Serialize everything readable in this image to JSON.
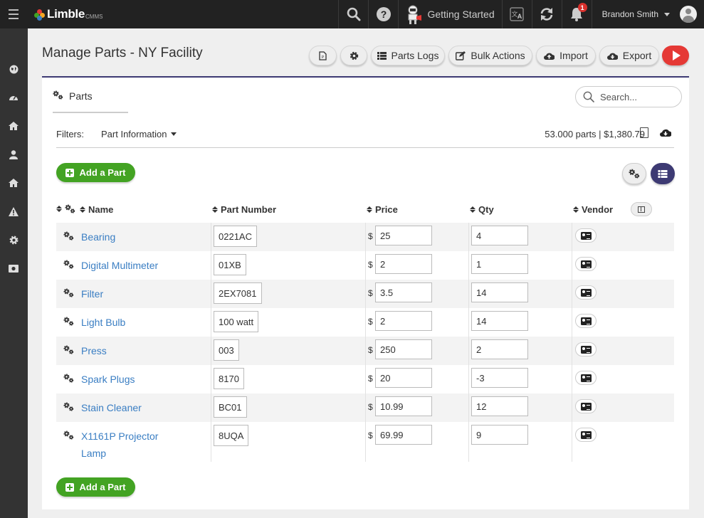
{
  "topbar": {
    "brand": "Limble",
    "brand_sub": "CMMS",
    "getting_started": "Getting Started",
    "notification_count": "1",
    "user_name": "Brandon Smith"
  },
  "page": {
    "title": "Manage Parts - NY Facility"
  },
  "header_buttons": {
    "parts_logs": "Parts Logs",
    "bulk_actions": "Bulk Actions",
    "import": "Import",
    "export": "Export"
  },
  "panel": {
    "tab_label": "Parts",
    "search_placeholder": "Search...",
    "filters_label": "Filters:",
    "filter_dropdown": "Part Information",
    "summary": "53.000 parts | $1,380.79",
    "add_button": "Add a Part"
  },
  "table": {
    "columns": {
      "name": "Name",
      "part_number": "Part Number",
      "price": "Price",
      "qty": "Qty",
      "vendor": "Vendor"
    },
    "currency_symbol": "$",
    "rows": [
      {
        "name": "Bearing",
        "part_number": "0221AC",
        "price": "25",
        "qty": "4"
      },
      {
        "name": "Digital Multimeter",
        "part_number": "01XB",
        "price": "2",
        "qty": "1"
      },
      {
        "name": "Filter",
        "part_number": "2EX7081",
        "price": "3.5",
        "qty": "14"
      },
      {
        "name": "Light Bulb",
        "part_number": "100 watt",
        "price": "2",
        "qty": "14"
      },
      {
        "name": "Press",
        "part_number": "003",
        "price": "250",
        "qty": "2"
      },
      {
        "name": "Spark Plugs",
        "part_number": "8170",
        "price": "20",
        "qty": "-3"
      },
      {
        "name": "Stain Cleaner",
        "part_number": "BC01",
        "price": "10.99",
        "qty": "12"
      },
      {
        "name": "X1161P Projector Lamp",
        "part_number": "8UQA",
        "price": "69.99",
        "qty": "9"
      }
    ]
  },
  "colors": {
    "accent_purple": "#3d3a73",
    "add_green": "#43a323",
    "link_blue": "#3a7ec3",
    "play_red": "#e53935"
  }
}
